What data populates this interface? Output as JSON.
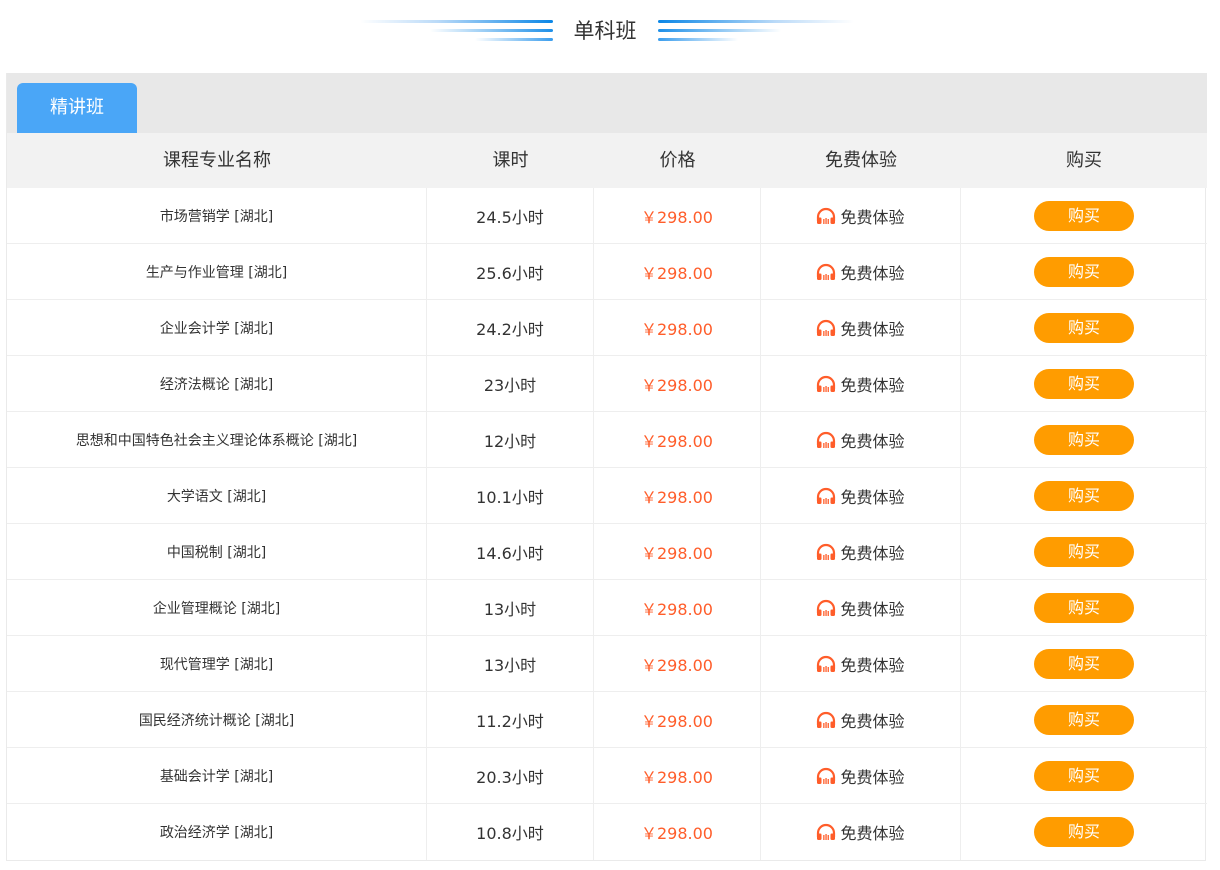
{
  "section_title": "单科班",
  "tabs": [
    {
      "label": "精讲班"
    }
  ],
  "columns": [
    "课程专业名称",
    "课时",
    "价格",
    "免费体验",
    "购买"
  ],
  "trial_icon": "headphones-icon",
  "colors": {
    "tab_active": "#4aa6f7",
    "price": "#ff5d2a",
    "buy_button": "#ff9c00",
    "trial_icon": "#ff5d2a"
  },
  "rows": [
    {
      "name": "市场营销学 [湖北]",
      "hours": "24.5小时",
      "price": "￥298.00",
      "trial": "免费体验",
      "buy": "购买"
    },
    {
      "name": "生产与作业管理 [湖北]",
      "hours": "25.6小时",
      "price": "￥298.00",
      "trial": "免费体验",
      "buy": "购买"
    },
    {
      "name": "企业会计学 [湖北]",
      "hours": "24.2小时",
      "price": "￥298.00",
      "trial": "免费体验",
      "buy": "购买"
    },
    {
      "name": "经济法概论 [湖北]",
      "hours": "23小时",
      "price": "￥298.00",
      "trial": "免费体验",
      "buy": "购买"
    },
    {
      "name": "思想和中国特色社会主义理论体系概论 [湖北]",
      "hours": "12小时",
      "price": "￥298.00",
      "trial": "免费体验",
      "buy": "购买"
    },
    {
      "name": "大学语文 [湖北]",
      "hours": "10.1小时",
      "price": "￥298.00",
      "trial": "免费体验",
      "buy": "购买"
    },
    {
      "name": "中国税制 [湖北]",
      "hours": "14.6小时",
      "price": "￥298.00",
      "trial": "免费体验",
      "buy": "购买"
    },
    {
      "name": "企业管理概论 [湖北]",
      "hours": "13小时",
      "price": "￥298.00",
      "trial": "免费体验",
      "buy": "购买"
    },
    {
      "name": "现代管理学 [湖北]",
      "hours": "13小时",
      "price": "￥298.00",
      "trial": "免费体验",
      "buy": "购买"
    },
    {
      "name": "国民经济统计概论 [湖北]",
      "hours": "11.2小时",
      "price": "￥298.00",
      "trial": "免费体验",
      "buy": "购买"
    },
    {
      "name": "基础会计学 [湖北]",
      "hours": "20.3小时",
      "price": "￥298.00",
      "trial": "免费体验",
      "buy": "购买"
    },
    {
      "name": "政治经济学 [湖北]",
      "hours": "10.8小时",
      "price": "￥298.00",
      "trial": "免费体验",
      "buy": "购买"
    }
  ]
}
